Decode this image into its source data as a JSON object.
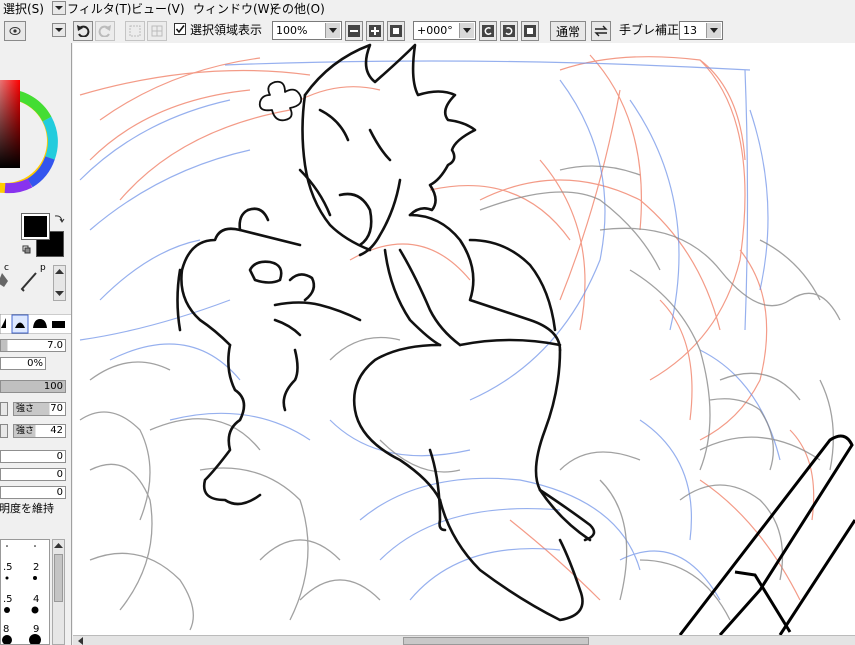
{
  "menu": {
    "select": "選択(S)",
    "filter": "フィルタ(T)",
    "view": "ビュー(V)",
    "window": "ウィンドウ(W)",
    "other": "その他(O)"
  },
  "toolbar": {
    "show_selection_label": "選択領域表示",
    "show_selection_checked": true,
    "zoom_value": "100%",
    "rotation_value": "+000°",
    "blend_mode": "通常",
    "stabilizer_label": "手ブレ補正",
    "stabilizer_value": "13"
  },
  "left_panel": {
    "color": {
      "fg": "#000000",
      "bg": "#000000"
    },
    "brush_size": "7.0",
    "min_size": "0%",
    "density": "100",
    "strength1_label": "強さ",
    "strength1_value": "70",
    "strength2_label": "強さ",
    "strength2_value": "42",
    "param1": "0",
    "param2": "0",
    "param3": "0",
    "keep_opacity": "明度を維持",
    "size_presets": [
      ".5",
      "2",
      ".5",
      "4",
      "8",
      "9"
    ]
  },
  "colors": {
    "sketch_red": "#f07a60",
    "sketch_blue": "#6b8fe8",
    "sketch_gray": "#8a8a8a",
    "lineart": "#111111"
  }
}
